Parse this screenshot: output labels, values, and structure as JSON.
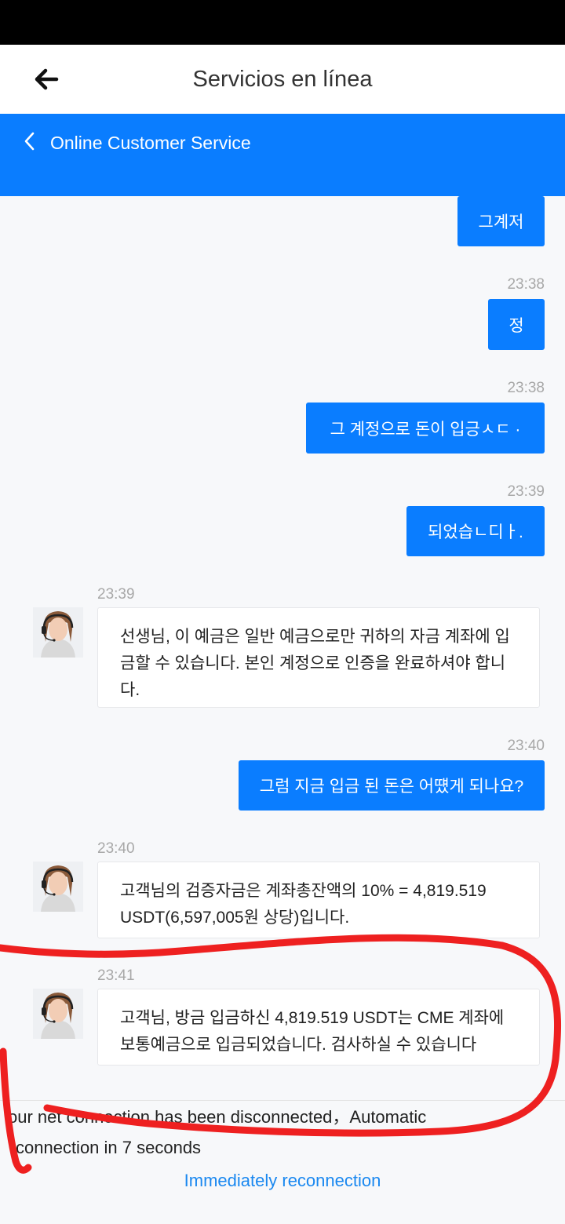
{
  "header": {
    "title": "Servicios en línea"
  },
  "chat_header": {
    "title": "Online Customer Service"
  },
  "messages": [
    {
      "side": "out",
      "text": "그계저"
    },
    {
      "side": "out",
      "time": "23:38",
      "text": "정"
    },
    {
      "side": "out",
      "time": "23:38",
      "text": "그 계정으로 돈이 입긍ㅅㄷ ·"
    },
    {
      "side": "out",
      "time": "23:39",
      "text": "되었습ㄴ디ㅏ."
    },
    {
      "side": "in",
      "time": "23:39",
      "text": "선생님, 이 예금은 일반 예금으로만 귀하의 자금 계좌에 입금할 수 있습니다. 본인 계정으로 인증을 완료하셔야 합니다."
    },
    {
      "side": "out",
      "time": "23:40",
      "text": "그럼 지금 입금 된 돈은 어떘게 되나요?"
    },
    {
      "side": "in",
      "time": "23:40",
      "text": "고객님의 검증자금은 계좌총잔액의 10% = 4,819.519 USDT(6,597,005원 상당)입니다."
    },
    {
      "side": "in",
      "time": "23:41",
      "text": "고객님, 방금 입금하신 4,819.519 USDT는 CME 계좌에 보통예금으로 입금되었습니다. 검사하실 수 있습니다"
    }
  ],
  "network": {
    "line1": "our net  connection has been disconnected，Automatic",
    "line2": "connection in 7 seconds",
    "reconnect_label": "Immediately reconnection"
  },
  "colors": {
    "accent": "#0a7dff",
    "link": "#1a88f0",
    "annotation": "#ee2020"
  }
}
